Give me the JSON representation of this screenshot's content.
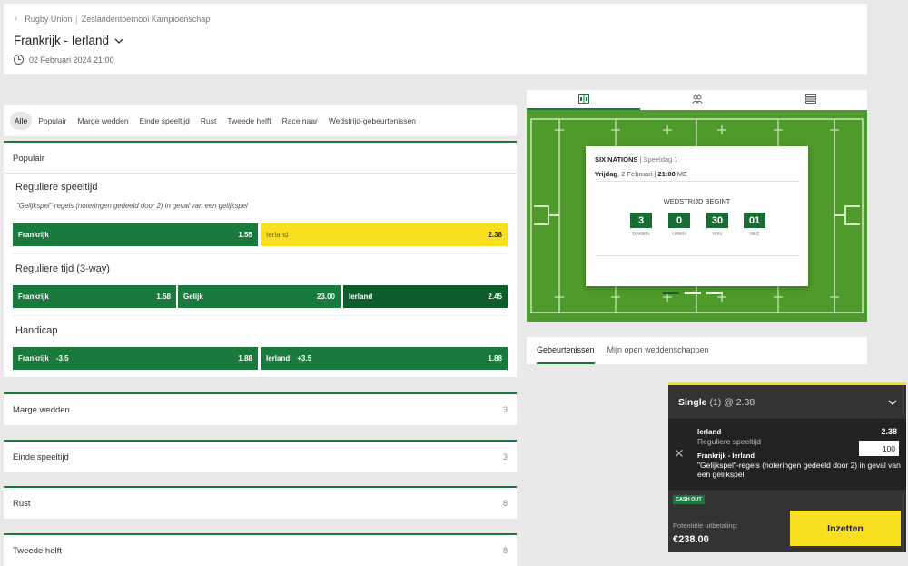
{
  "header": {
    "breadcrumb": [
      "Rugby Union",
      "Zeslandentoernooi Kampioenschap"
    ],
    "match_title": "Frankrijk - Ierland",
    "date": "02 Februari 2024 21:00"
  },
  "filters": {
    "tabs": [
      "Alle",
      "Populair",
      "Marge wedden",
      "Einde speeltijd",
      "Rust",
      "Tweede helft",
      "Race naar",
      "Wedstrijd-gebeurtenissen"
    ],
    "active": "Alle"
  },
  "populair": {
    "title": "Populair",
    "markets": [
      {
        "title": "Reguliere speeltijd",
        "note": "\"Gelijkspel\"-regels (noteringen gedeeld door 2) in geval van een gelijkspel",
        "selections": [
          {
            "label": "Frankrijk",
            "odds": "1.55",
            "selected": false
          },
          {
            "label": "Ierland",
            "odds": "2.38",
            "selected": true
          }
        ]
      },
      {
        "title": "Reguliere tijd (3-way)",
        "selections": [
          {
            "label": "Frankrijk",
            "odds": "1.58"
          },
          {
            "label": "Gelijk",
            "odds": "23.00"
          },
          {
            "label": "Ierland",
            "odds": "2.45"
          }
        ]
      },
      {
        "title": "Handicap",
        "selections": [
          {
            "label": "Frankrijk",
            "handicap": "-3.5",
            "odds": "1.88"
          },
          {
            "label": "Ierland",
            "handicap": "+3.5",
            "odds": "1.88"
          }
        ]
      }
    ]
  },
  "collapsed_markets": [
    {
      "title": "Marge wedden",
      "count": "3"
    },
    {
      "title": "Einde speeltijd",
      "count": "3"
    },
    {
      "title": "Rust",
      "count": "8"
    },
    {
      "title": "Tweede helft",
      "count": "8"
    }
  ],
  "widget": {
    "tab_icons": [
      "scoreboard-icon",
      "lineup-icon",
      "list-icon"
    ],
    "competition": "SIX NATIONS",
    "matchday": "Speeldag 1",
    "weekday": "Vrijdag",
    "date": "2 Februari",
    "time": "21:00",
    "timezone": "ME",
    "starts_label": "WEDSTRIJD BEGINT",
    "countdown": [
      {
        "value": "3",
        "unit": "DAGEN"
      },
      {
        "value": "0",
        "unit": "UREN"
      },
      {
        "value": "30",
        "unit": "MIN"
      },
      {
        "value": "01",
        "unit": "SEC"
      }
    ]
  },
  "event_tabs": {
    "tabs": [
      "Gebeurtenissen",
      "Mijn open weddenschappen"
    ],
    "active": "Gebeurtenissen"
  },
  "betslip": {
    "type": "Single",
    "count": "(1)",
    "odds_label": "@ 2.38",
    "selection": "Ierland",
    "odds": "2.38",
    "market": "Reguliere speeltijd",
    "match": "Frankrijk - Ierland",
    "rule": "\"Gelijkspel\"-regels (noteringen gedeeld door 2) in geval van een gelijkspel",
    "stake": "100",
    "cashout": "CASH OUT",
    "payout_label": "Potentiële uitbetaling:",
    "payout_value": "€238.00",
    "place_label": "Inzetten"
  },
  "colors": {
    "accent_green": "#1a7a3e",
    "dark_green": "#0f5c2c",
    "selected_yellow": "#f8e020",
    "pitch_green": "#4e9a2a"
  }
}
